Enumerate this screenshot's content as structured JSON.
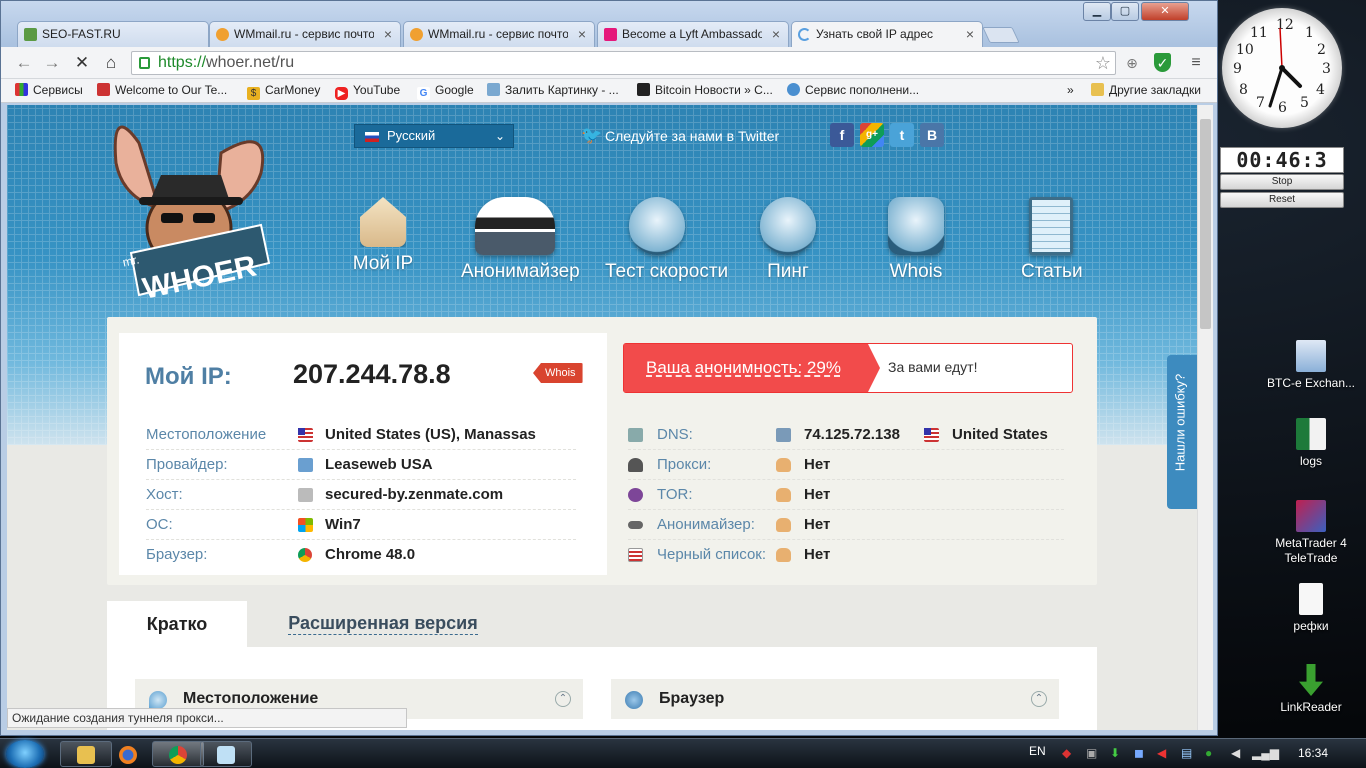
{
  "browser": {
    "tabs": [
      {
        "title": "SEO-FAST.RU",
        "icon": "seofast-icon"
      },
      {
        "title": "WMmail.ru - сервис почто",
        "icon": "wmmail-icon"
      },
      {
        "title": "WMmail.ru - сервис почто",
        "icon": "wmmail-icon"
      },
      {
        "title": "Become a Lyft Ambassado",
        "icon": "lyft-icon"
      },
      {
        "title": "Узнать свой IP адрес",
        "icon": "loading-icon"
      }
    ],
    "url_scheme": "https://",
    "url_rest": "whoer.net/ru",
    "bookmarks": [
      {
        "label": "Сервисы",
        "icon": "apps-icon"
      },
      {
        "label": "Welcome to Our Te...",
        "icon": "site-icon"
      },
      {
        "label": "CarMoney",
        "icon": "dollar-icon"
      },
      {
        "label": "YouTube",
        "icon": "youtube-icon"
      },
      {
        "label": "Google",
        "icon": "google-icon"
      },
      {
        "label": "Залить Картинку - ...",
        "icon": "image-icon"
      },
      {
        "label": "Bitcoin Новости » С...",
        "icon": "bitcoin-icon"
      },
      {
        "label": "Сервис пополнени...",
        "icon": "globe-icon"
      }
    ],
    "bookmarks_more": "»",
    "other_bookmarks": "Другие закладки",
    "status_text": "Ожидание создания туннеля прокси..."
  },
  "site": {
    "language": "Русский",
    "twitter_follow": "Следуйте за нами в Twitter",
    "social": [
      "f",
      "g+",
      "t",
      "B"
    ],
    "logo_text_small": "mr.",
    "logo_text_big": "WHOER",
    "nav": [
      "Мой IP",
      "Анонимайзер",
      "Тест скорости",
      "Пинг",
      "Whois",
      "Статьи"
    ],
    "ip_label": "Мой IP:",
    "ip_value": "207.244.78.8",
    "whois_badge": "Whois",
    "anonymity_label": "Ваша анонимность: 29%",
    "anonymity_message": "За вами едут!",
    "left_rows": [
      {
        "key": "Местоположение",
        "value": "United States (US), Manassas",
        "icon": "us-flag-icon"
      },
      {
        "key": "Провайдер:",
        "value": "Leaseweb USA",
        "icon": "provider-icon"
      },
      {
        "key": "Хост:",
        "value": "secured-by.zenmate.com",
        "icon": "host-icon"
      },
      {
        "key": "ОС:",
        "value": "Win7",
        "icon": "windows-icon"
      },
      {
        "key": "Браузер:",
        "value": "Chrome 48.0",
        "icon": "chrome-icon"
      }
    ],
    "right_rows": [
      {
        "key": "DNS:",
        "value": "74.125.72.138",
        "extra": "United States",
        "icon": "dns-icon"
      },
      {
        "key": "Прокси:",
        "value": "Нет",
        "icon": "spy-icon"
      },
      {
        "key": "TOR:",
        "value": "Нет",
        "icon": "tor-icon"
      },
      {
        "key": "Анонимайзер:",
        "value": "Нет",
        "icon": "glasses-icon"
      },
      {
        "key": "Черный список:",
        "value": "Нет",
        "icon": "blacklist-icon"
      }
    ],
    "tab_short": "Кратко",
    "tab_extended": "Расширенная версия",
    "section_location": "Местоположение",
    "section_browser": "Браузер",
    "feedback": "Нашли ошибку?"
  },
  "desktop": {
    "timer": "00:46:3",
    "stop": "Stop",
    "reset": "Reset",
    "icons": [
      {
        "label": "BTC-e Exchan...",
        "icon": "shortcut-icon"
      },
      {
        "label": "logs",
        "icon": "excel-icon"
      },
      {
        "label": "MetaTrader 4 TeleTrade",
        "icon": "metatrader-icon"
      },
      {
        "label": "рефки",
        "icon": "text-file-icon"
      },
      {
        "label": "LinkReader",
        "icon": "download-arrow-icon"
      }
    ],
    "clock_numbers": [
      "12",
      "1",
      "2",
      "3",
      "4",
      "5",
      "6",
      "7",
      "8",
      "9",
      "10",
      "11"
    ]
  },
  "taskbar": {
    "lang": "EN",
    "time": "16:34"
  },
  "colors": {
    "accent_red": "#f24b4b",
    "label_blue": "#5b87a9",
    "hero_blue": "#3793c4"
  }
}
